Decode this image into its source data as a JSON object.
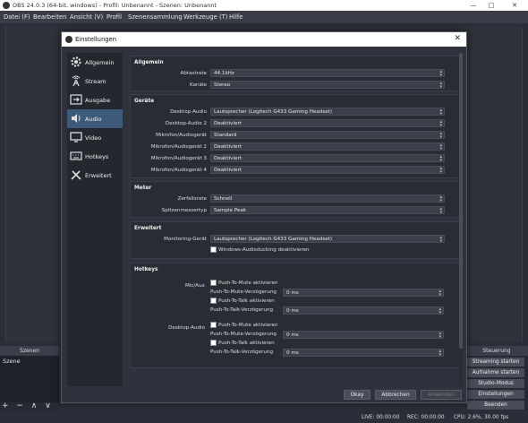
{
  "window": {
    "title": "OBS 24.0.3 (64-bit, windows) - Profil: Unbenannt - Szenen: Unbenannt"
  },
  "menu": [
    "Datei (F)",
    "Bearbeiten",
    "Ansicht (V)",
    "Profil",
    "Szenensammlung",
    "Werkzeuge (T)",
    "Hilfe"
  ],
  "docks": {
    "scenes_title": "Szenen",
    "scene_item": "Szene",
    "scene_buttons": "+ − ∧ ∨",
    "controls_title": "Steuerung",
    "controls": [
      "Streaming starten",
      "Aufnahme starten",
      "Studio-Modus",
      "Einstellungen",
      "Beenden"
    ]
  },
  "status": {
    "live": "LIVE: 00:00:00",
    "rec": "REC: 00:00:00",
    "cpu": "CPU: 2.6%, 30.00 fps"
  },
  "dialog": {
    "title": "Einstellungen",
    "nav": [
      {
        "label": "Allgemein",
        "icon": "gear-icon"
      },
      {
        "label": "Stream",
        "icon": "antenna-icon"
      },
      {
        "label": "Ausgabe",
        "icon": "output-icon"
      },
      {
        "label": "Audio",
        "icon": "speaker-icon"
      },
      {
        "label": "Video",
        "icon": "monitor-icon"
      },
      {
        "label": "Hotkeys",
        "icon": "keyboard-icon"
      },
      {
        "label": "Erweitert",
        "icon": "tools-icon"
      }
    ],
    "active_nav": "Audio",
    "allgemein": {
      "title": "Allgemein",
      "rows": [
        {
          "label": "Abtastrate",
          "value": "44.1kHz"
        },
        {
          "label": "Kanäle",
          "value": "Stereo"
        }
      ]
    },
    "geraete": {
      "title": "Geräte",
      "rows": [
        {
          "label": "Desktop-Audio",
          "value": "Lautsprecher (Logitech G433 Gaming Headset)"
        },
        {
          "label": "Desktop-Audio 2",
          "value": "Deaktiviert"
        },
        {
          "label": "Mikrofon/Audiogerät",
          "value": "Standard"
        },
        {
          "label": "Mikrofon/Audiogerät 2",
          "value": "Deaktiviert"
        },
        {
          "label": "Mikrofon/Audiogerät 3",
          "value": "Deaktiviert"
        },
        {
          "label": "Mikrofon/Audiogerät 4",
          "value": "Deaktiviert"
        }
      ]
    },
    "meter": {
      "title": "Meter",
      "rows": [
        {
          "label": "Zerfallsrate",
          "value": "Schnell"
        },
        {
          "label": "Spitzenmessertyp",
          "value": "Sample Peak"
        }
      ]
    },
    "erweitert": {
      "title": "Erweitert",
      "monitoring_label": "Monitoring-Gerät",
      "monitoring_value": "Lautsprecher (Logitech G433 Gaming Headset)",
      "ducking_label": "Windows-Audioducking deaktivieren"
    },
    "hotkeys": {
      "title": "Hotkeys",
      "sections": [
        {
          "name": "Mic/Aux",
          "ptm": "Push-To-Mute aktivieren",
          "ptm_delay_label": "Push-To-Mute-Verzögerung",
          "ptm_delay": "0 ms",
          "ptt": "Push-To-Talk aktivieren",
          "ptt_delay_label": "Push-To-Talk-Verzögerung",
          "ptt_delay": "0 ms"
        },
        {
          "name": "Desktop-Audio",
          "ptm": "Push-To-Mute aktivieren",
          "ptm_delay_label": "Push-To-Mute-Verzögerung",
          "ptm_delay": "0 ms",
          "ptt": "Push-To-Talk aktivieren",
          "ptt_delay_label": "Push-To-Talk-Verzögerung",
          "ptt_delay": "0 ms"
        }
      ]
    },
    "buttons": {
      "ok": "Okay",
      "cancel": "Abbrechen",
      "apply": "Anwenden"
    }
  }
}
